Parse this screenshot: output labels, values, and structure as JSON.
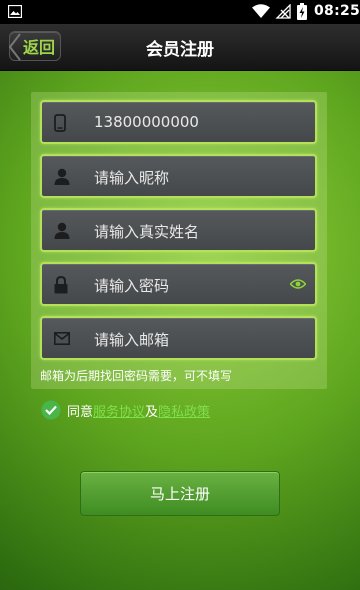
{
  "status_bar": {
    "time": "08:25"
  },
  "header": {
    "back_label": "返回",
    "title": "会员注册"
  },
  "form": {
    "phone_value": "13800000000",
    "nickname_placeholder": "请输入昵称",
    "realname_placeholder": "请输入真实姓名",
    "password_placeholder": "请输入密码",
    "email_placeholder": "请输入邮箱",
    "email_note": "邮箱为后期找回密码需要，可不填写"
  },
  "agreement": {
    "prefix": "同意",
    "service_link": "服务协议",
    "and": "及",
    "privacy_link": "隐私政策"
  },
  "submit_label": "马上注册",
  "colors": {
    "accent": "#9ed54a",
    "link": "#7fe04a",
    "field_border": "#b4e05a"
  }
}
